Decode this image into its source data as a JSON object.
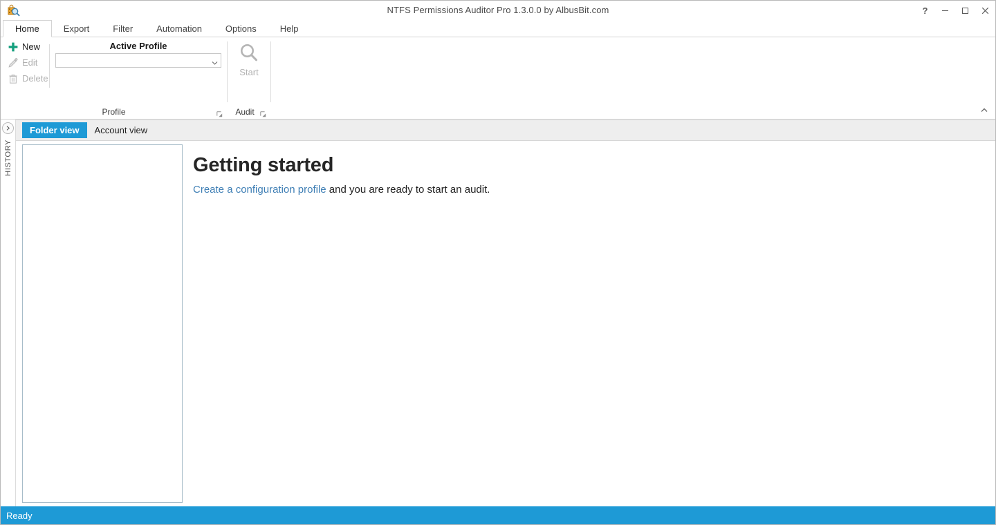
{
  "window": {
    "title": "NTFS Permissions Auditor Pro 1.3.0.0 by AlbusBit.com",
    "app_icon": "bag-magnifier-icon",
    "controls": {
      "help": "?",
      "minimize": "minimize-icon",
      "maximize": "maximize-icon",
      "close": "close-icon"
    }
  },
  "ribbon": {
    "tabs": [
      {
        "label": "Home",
        "active": true
      },
      {
        "label": "Export",
        "active": false
      },
      {
        "label": "Filter",
        "active": false
      },
      {
        "label": "Automation",
        "active": false
      },
      {
        "label": "Options",
        "active": false
      },
      {
        "label": "Help",
        "active": false
      }
    ],
    "collapse_icon": "chevron-up-icon",
    "groups": {
      "profile": {
        "title": "Profile",
        "launcher_icon": "dialog-launcher-icon",
        "buttons": [
          {
            "label": "New",
            "icon": "plus-icon",
            "enabled": true
          },
          {
            "label": "Edit",
            "icon": "pencil-icon",
            "enabled": false
          },
          {
            "label": "Delete",
            "icon": "trash-icon",
            "enabled": false
          }
        ],
        "active_profile": {
          "label": "Active Profile",
          "value": "",
          "placeholder": "",
          "dropdown_icon": "chevron-down-icon"
        }
      },
      "audit": {
        "title": "Audit",
        "launcher_icon": "dialog-launcher-icon",
        "start_button": {
          "label": "Start",
          "icon": "magnifier-icon",
          "enabled": false
        }
      }
    }
  },
  "sidebar": {
    "expand_icon": "chevron-right-icon",
    "label": "HISTORY"
  },
  "view_tabs": [
    {
      "label": "Folder view",
      "active": true
    },
    {
      "label": "Account view",
      "active": false
    }
  ],
  "tree_panel": {
    "items": []
  },
  "getting_started": {
    "title": "Getting started",
    "link_text": "Create a configuration profile",
    "rest_text": " and you are ready to start an audit."
  },
  "status_bar": {
    "text": "Ready"
  },
  "colors": {
    "accent": "#1e9ad6",
    "link": "#3f7fb5",
    "new_icon_green": "#15a07e",
    "ribbon_border": "#d4d4d4"
  }
}
